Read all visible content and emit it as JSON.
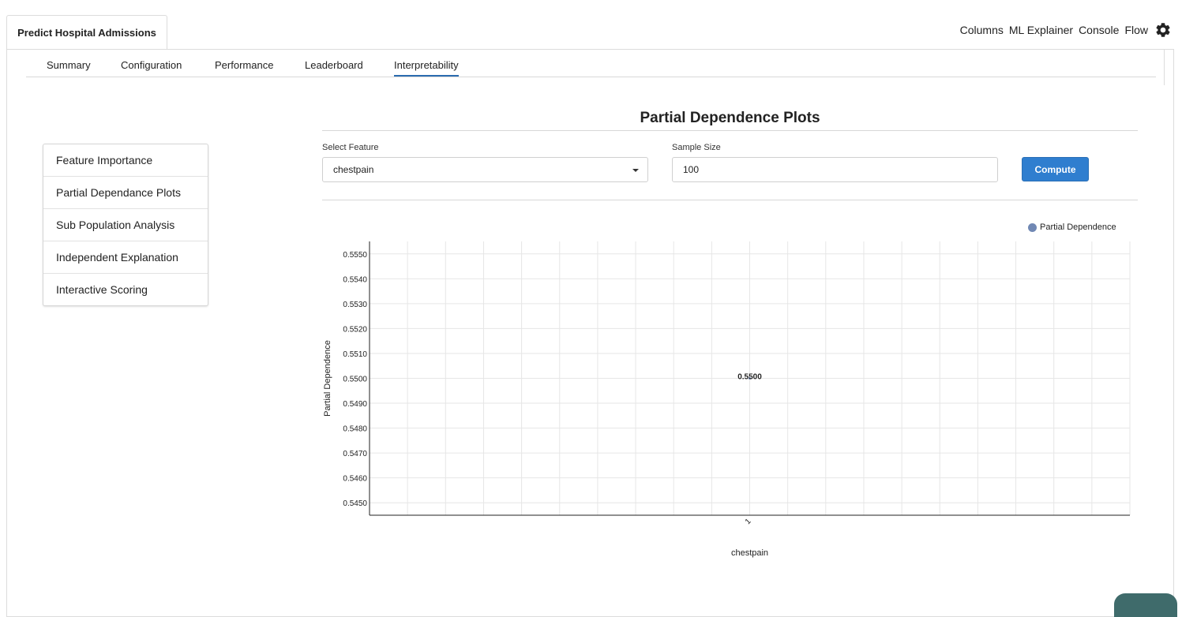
{
  "project_tab": {
    "label": "Predict Hospital Admissions"
  },
  "topnav": {
    "links": [
      "Columns",
      "ML Explainer",
      "Console",
      "Flow"
    ],
    "settings_icon": "gear-icon"
  },
  "subtabs": {
    "items": [
      "Summary",
      "Configuration",
      "Performance",
      "Leaderboard",
      "Interpretability"
    ],
    "active": "Interpretability"
  },
  "side_menu": {
    "items": [
      "Feature Importance",
      "Partial Dependance Plots",
      "Sub Population Analysis",
      "Independent Explanation",
      "Interactive Scoring"
    ]
  },
  "pdp": {
    "title": "Partial Dependence Plots",
    "select_feature_label": "Select Feature",
    "select_feature_value": "chestpain",
    "sample_size_label": "Sample Size",
    "sample_size_value": "100",
    "compute_label": "Compute"
  },
  "colors": {
    "accent": "#2f7ecf",
    "series": "#7088b4",
    "active_tab": "#2b6cb0"
  },
  "chart_data": {
    "type": "line",
    "legend": "Partial Dependence",
    "legend_position": "top-right",
    "xlabel": "chestpain",
    "ylabel": "Partial Dependence",
    "x_categories": [
      "1"
    ],
    "series": [
      {
        "name": "Partial Dependence",
        "values": [
          0.55
        ]
      }
    ],
    "data_labels": [
      "0.5500"
    ],
    "y_ticks": [
      "0.5550",
      "0.5540",
      "0.5530",
      "0.5520",
      "0.5510",
      "0.5500",
      "0.5490",
      "0.5480",
      "0.5470",
      "0.5460",
      "0.5450"
    ],
    "ylim": [
      0.5445,
      0.5555
    ],
    "grid": true
  }
}
